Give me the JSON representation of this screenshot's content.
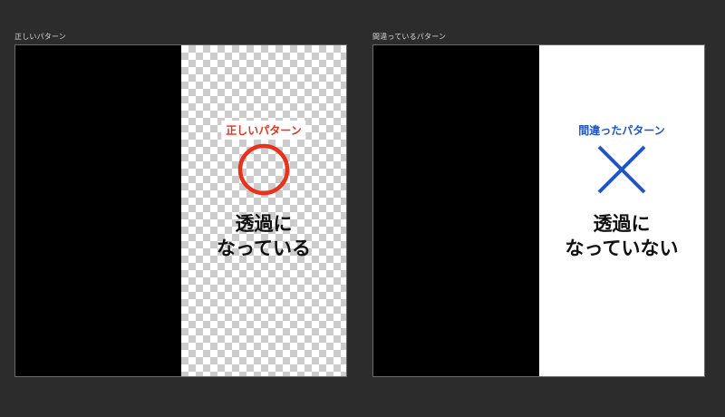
{
  "panels": {
    "correct": {
      "title": "正しいパターン",
      "tag": "正しいパターン",
      "caption_line1": "透過に",
      "caption_line2": "なっている",
      "mark": "circle-icon",
      "accent_color": "#e8321c",
      "background": "transparent-checkerboard"
    },
    "wrong": {
      "title": "間違っているパターン",
      "tag": "間違ったパターン",
      "caption_line1": "透過に",
      "caption_line2": "なっていない",
      "mark": "cross-icon",
      "accent_color": "#1f55c8",
      "background": "white"
    }
  }
}
